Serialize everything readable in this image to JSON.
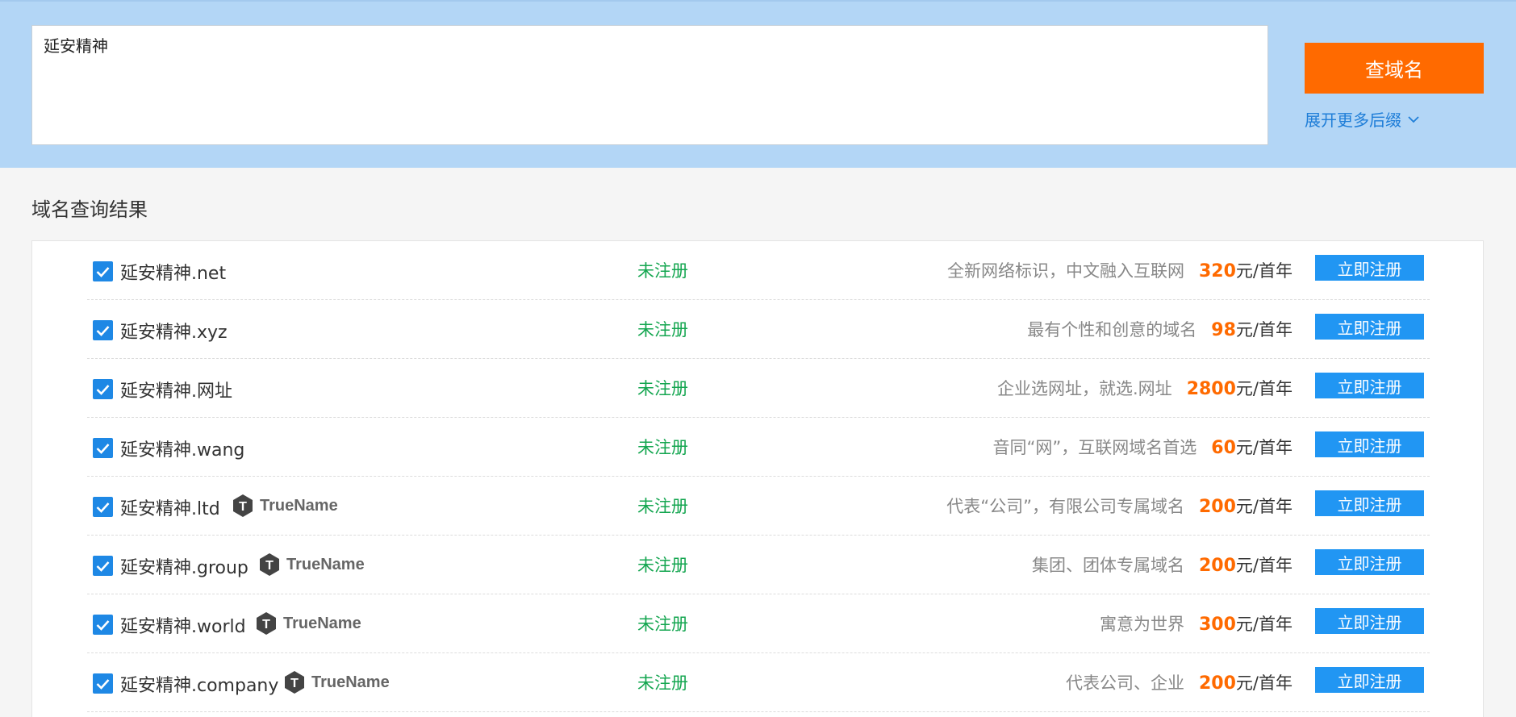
{
  "search": {
    "query": "延安精神",
    "button_label": "查域名",
    "expand_label": "展开更多后缀"
  },
  "results": {
    "title": "域名查询结果",
    "rows": [
      {
        "domain": "延安精神.net",
        "truename": false,
        "status": "未注册",
        "desc": "全新网络标识，中文融入互联网",
        "price": "320",
        "unit": "元/首年",
        "action": "立即注册"
      },
      {
        "domain": "延安精神.xyz",
        "truename": false,
        "status": "未注册",
        "desc": "最有个性和创意的域名",
        "price": "98",
        "unit": "元/首年",
        "action": "立即注册"
      },
      {
        "domain": "延安精神.网址",
        "truename": false,
        "status": "未注册",
        "desc": "企业选网址，就选.网址",
        "price": "2800",
        "unit": "元/首年",
        "action": "立即注册"
      },
      {
        "domain": "延安精神.wang",
        "truename": false,
        "status": "未注册",
        "desc": "音同“网”，互联网域名首选",
        "price": "60",
        "unit": "元/首年",
        "action": "立即注册"
      },
      {
        "domain": "延安精神.ltd",
        "truename": true,
        "status": "未注册",
        "desc": "代表“公司”，有限公司专属域名",
        "price": "200",
        "unit": "元/首年",
        "action": "立即注册"
      },
      {
        "domain": "延安精神.group",
        "truename": true,
        "status": "未注册",
        "desc": "集团、团体专属域名",
        "price": "200",
        "unit": "元/首年",
        "action": "立即注册"
      },
      {
        "domain": "延安精神.world",
        "truename": true,
        "status": "未注册",
        "desc": "寓意为世界",
        "price": "300",
        "unit": "元/首年",
        "action": "立即注册"
      },
      {
        "domain": "延安精神.company",
        "truename": true,
        "status": "未注册",
        "desc": "代表公司、企业",
        "price": "200",
        "unit": "元/首年",
        "action": "立即注册"
      }
    ],
    "truename_label": "TrueName"
  },
  "colors": {
    "accent": "#ff6a00",
    "register_button": "#2196f3",
    "status_green": "#14a650",
    "search_bg": "#b3d6f6"
  },
  "icons": {
    "checkbox": "checkmark-icon",
    "truename": "truename-logo-icon",
    "expand": "chevron-down-icon"
  }
}
